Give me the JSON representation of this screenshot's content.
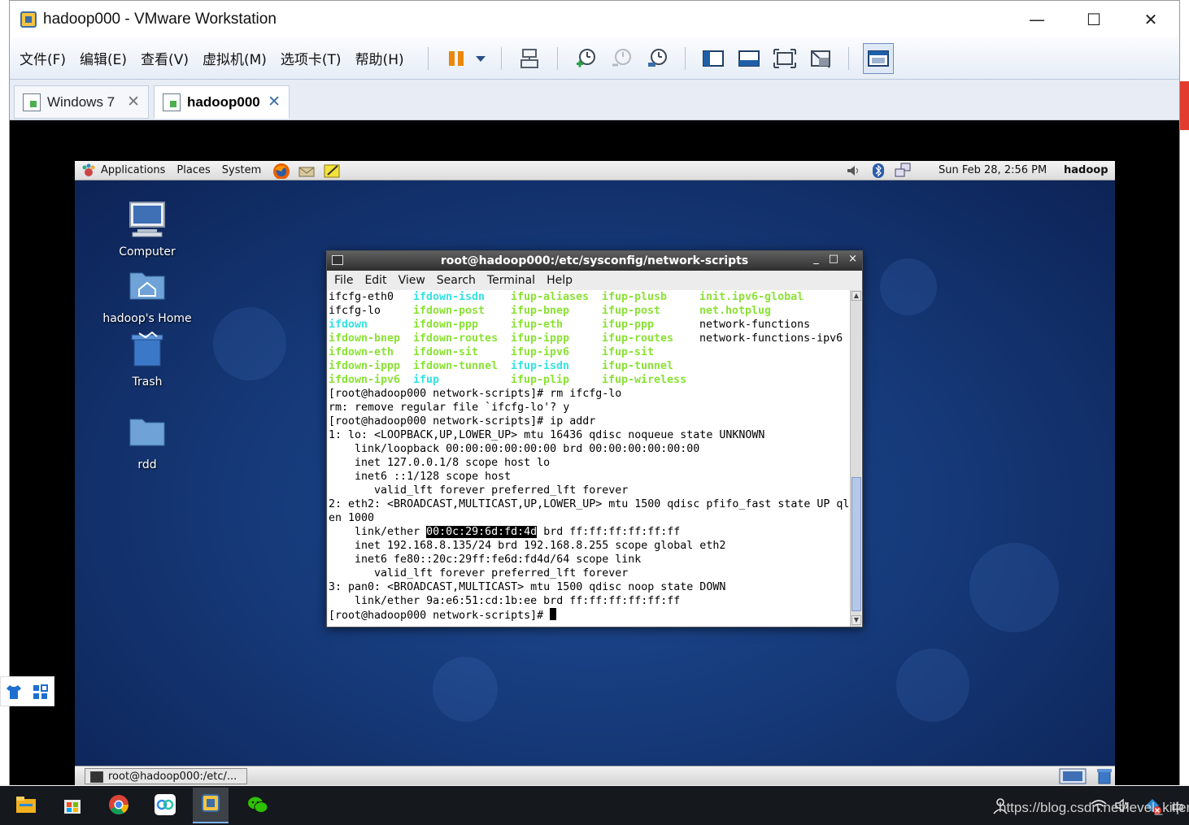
{
  "window": {
    "title": "hadoop000 - VMware Workstation",
    "minimize": "—",
    "maximize": "☐",
    "close": "✕"
  },
  "menu": [
    "文件(F)",
    "编辑(E)",
    "查看(V)",
    "虚拟机(M)",
    "选项卡(T)",
    "帮助(H)"
  ],
  "tabs": [
    {
      "label": "Windows 7"
    },
    {
      "label": "hadoop000"
    }
  ],
  "tab_close": "✕",
  "guest_panel": {
    "menus": [
      "Applications",
      "Places",
      "System"
    ],
    "clock": "Sun Feb 28,  2:56 PM",
    "user": "hadoop"
  },
  "desktop_icons": [
    {
      "label": "Computer"
    },
    {
      "label": "hadoop's Home"
    },
    {
      "label": "Trash"
    },
    {
      "label": "rdd"
    }
  ],
  "terminal": {
    "title": "root@hadoop000:/etc/sysconfig/network-scripts",
    "controls": [
      "_",
      "□",
      "×"
    ],
    "menu": [
      "File",
      "Edit",
      "View",
      "Search",
      "Terminal",
      "Help"
    ],
    "listing": [
      [
        "ifcfg-eth0",
        "ifdown-isdn",
        "ifup-aliases",
        "ifup-plusb",
        "init.ipv6-global"
      ],
      [
        "ifcfg-lo",
        "ifdown-post",
        "ifup-bnep",
        "ifup-post",
        "net.hotplug"
      ],
      [
        "ifdown",
        "ifdown-ppp",
        "ifup-eth",
        "ifup-ppp",
        "network-functions"
      ],
      [
        "ifdown-bnep",
        "ifdown-routes",
        "ifup-ippp",
        "ifup-routes",
        "network-functions-ipv6"
      ],
      [
        "ifdown-eth",
        "ifdown-sit",
        "ifup-ipv6",
        "ifup-sit",
        ""
      ],
      [
        "ifdown-ippp",
        "ifdown-tunnel",
        "ifup-isdn",
        "ifup-tunnel",
        ""
      ],
      [
        "ifdown-ipv6",
        "ifup",
        "ifup-plip",
        "ifup-wireless",
        ""
      ]
    ],
    "listing_styles": [
      [
        "plain",
        "link",
        "exec",
        "exec",
        "exec"
      ],
      [
        "plain",
        "exec",
        "exec",
        "exec",
        "exec"
      ],
      [
        "link",
        "exec",
        "exec",
        "exec",
        "plain"
      ],
      [
        "exec",
        "exec",
        "exec",
        "exec",
        "plain"
      ],
      [
        "exec",
        "exec",
        "exec",
        "exec",
        "plain"
      ],
      [
        "exec",
        "exec",
        "link",
        "exec",
        "plain"
      ],
      [
        "exec",
        "link",
        "exec",
        "exec",
        "plain"
      ]
    ],
    "lines": [
      "[root@hadoop000 network-scripts]# rm ifcfg-lo",
      "rm: remove regular file `ifcfg-lo'? y",
      "[root@hadoop000 network-scripts]# ip addr",
      "1: lo: <LOOPBACK,UP,LOWER_UP> mtu 16436 qdisc noqueue state UNKNOWN",
      "    link/loopback 00:00:00:00:00:00 brd 00:00:00:00:00:00",
      "    inet 127.0.0.1/8 scope host lo",
      "    inet6 ::1/128 scope host",
      "       valid_lft forever preferred_lft forever",
      "2: eth2: <BROADCAST,MULTICAST,UP,LOWER_UP> mtu 1500 qdisc pfifo_fast state UP ql",
      "en 1000"
    ],
    "ether_prefix": "    link/ether ",
    "ether_mac": "00:0c:29:6d:fd:4d",
    "ether_suffix": " brd ff:ff:ff:ff:ff:ff",
    "lines2": [
      "    inet 192.168.8.135/24 brd 192.168.8.255 scope global eth2",
      "    inet6 fe80::20c:29ff:fe6d:fd4d/64 scope link",
      "       valid_lft forever preferred_lft forever",
      "3: pan0: <BROADCAST,MULTICAST> mtu 1500 qdisc noop state DOWN",
      "    link/ether 9a:e6:51:cd:1b:ee brd ff:ff:ff:ff:ff:ff"
    ],
    "prompt": "[root@hadoop000 network-scripts]# "
  },
  "guest_taskbar": {
    "item": "root@hadoop000:/etc/..."
  },
  "host": {
    "watermark": "https://blog.csdn.net/level_killer",
    "ime": "中"
  }
}
